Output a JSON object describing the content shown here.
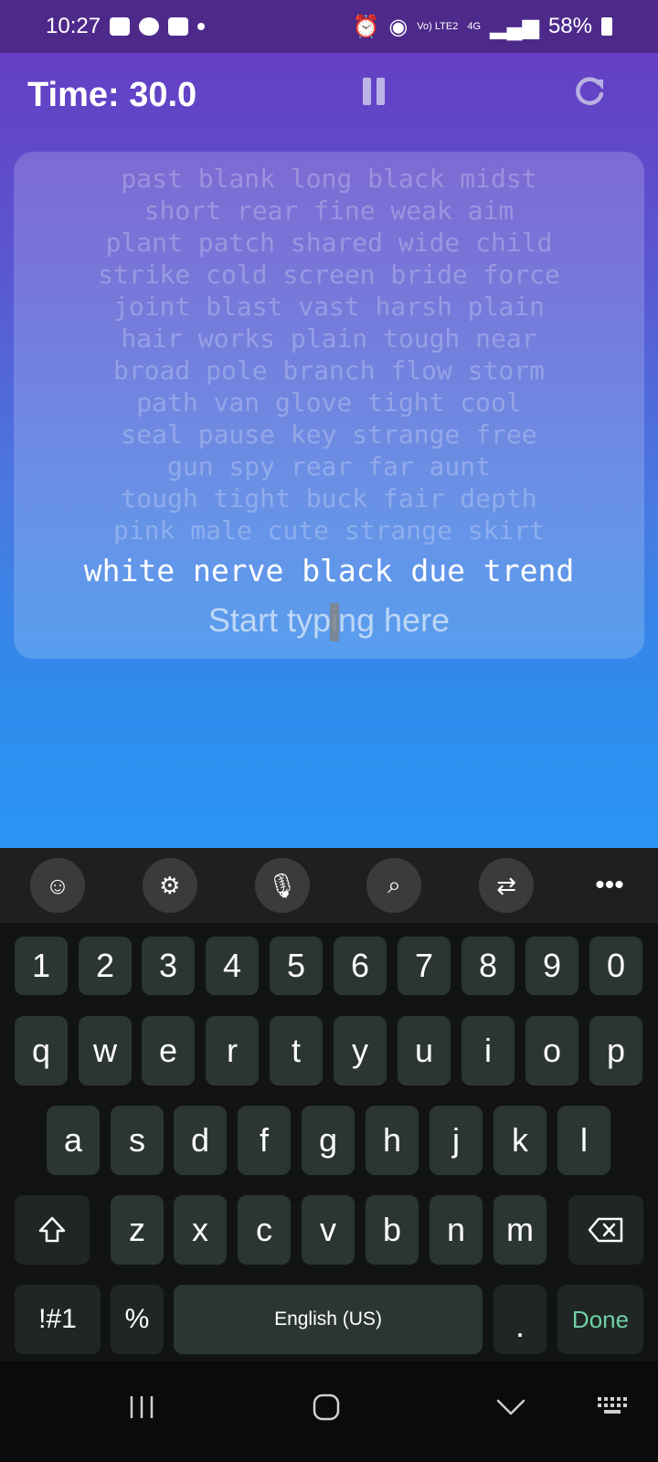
{
  "status_bar": {
    "time": "10:27",
    "network_small": "Vo) LTE2",
    "network_type": "4G",
    "battery": "58%"
  },
  "header": {
    "timer": "Time: 30.0",
    "pause_icon": "pause-icon",
    "restart_icon": "restart-icon"
  },
  "words": {
    "lines": [
      "past blank long black midst",
      "short rear fine weak aim",
      "plant patch shared wide child",
      "strike cold screen bride force",
      "joint blast vast harsh plain",
      "hair works plain tough near",
      "broad pole branch flow storm",
      "path van glove tight cool",
      "seal pause key strange free",
      "gun spy rear far aunt",
      "tough tight buck fair depth",
      "pink male cute strange skirt"
    ],
    "active_line": "white nerve black due trend"
  },
  "input": {
    "placeholder": "Start typing here"
  },
  "keyboard": {
    "toolbar": [
      "emoji-icon",
      "settings-icon",
      "mic-icon",
      "search-icon",
      "translate-icon",
      "more-icon"
    ],
    "number_row": [
      "1",
      "2",
      "3",
      "4",
      "5",
      "6",
      "7",
      "8",
      "9",
      "0"
    ],
    "row1": [
      "q",
      "w",
      "e",
      "r",
      "t",
      "y",
      "u",
      "i",
      "o",
      "p"
    ],
    "row2": [
      "a",
      "s",
      "d",
      "f",
      "g",
      "h",
      "j",
      "k",
      "l"
    ],
    "row3": [
      "z",
      "x",
      "c",
      "v",
      "b",
      "n",
      "m"
    ],
    "symbols_key": "!#1",
    "percent_key": "%",
    "space_label": "English (US)",
    "period_key": ".",
    "done_key": "Done"
  },
  "colors": {
    "gradient_top": "#653fc4",
    "gradient_bottom": "#2a95f3",
    "key_bg": "#2b3632",
    "done_green": "#6fd0a6"
  }
}
